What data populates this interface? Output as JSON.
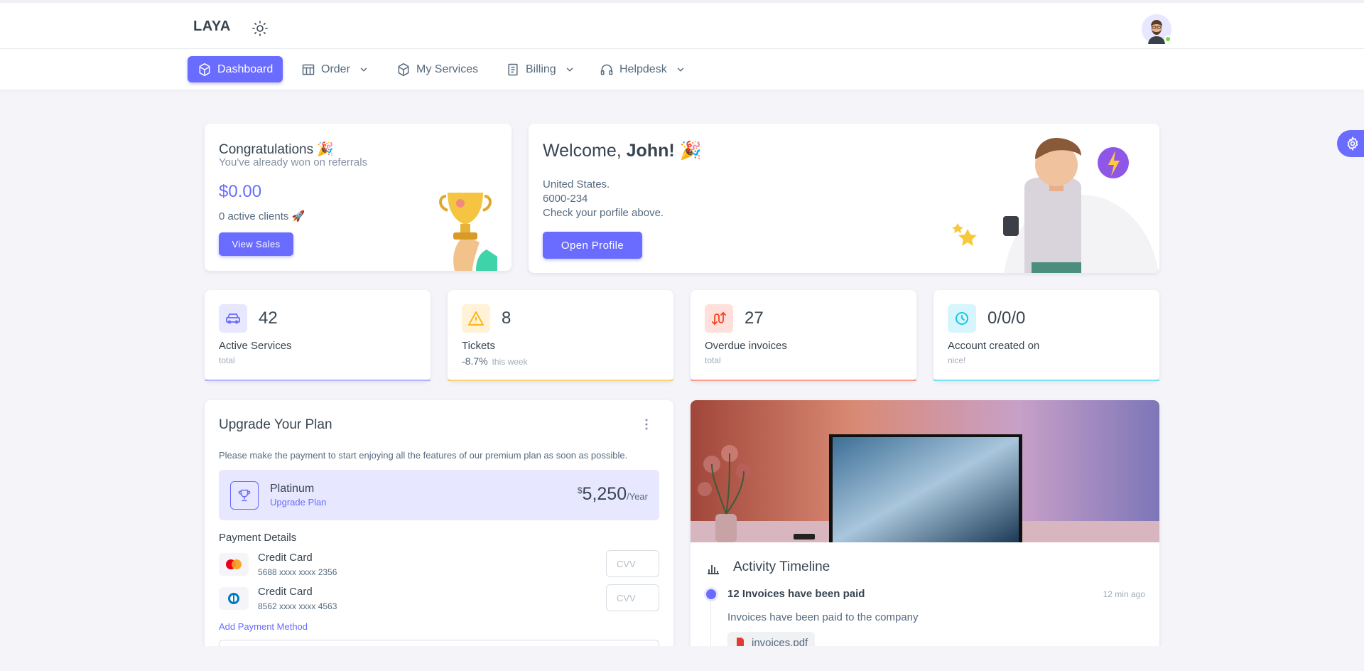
{
  "brand": {
    "name": "LAYA"
  },
  "nav": {
    "items": [
      {
        "label": "Dashboard",
        "icon": "cube-icon",
        "active": true,
        "dropdown": false
      },
      {
        "label": "Order",
        "icon": "table-icon",
        "active": false,
        "dropdown": true
      },
      {
        "label": "My Services",
        "icon": "box-icon",
        "active": false,
        "dropdown": false
      },
      {
        "label": "Billing",
        "icon": "file-icon",
        "active": false,
        "dropdown": true
      },
      {
        "label": "Helpdesk",
        "icon": "headset-icon",
        "active": false,
        "dropdown": true
      }
    ]
  },
  "congrats": {
    "title": "Congratulations 🎉",
    "subtitle": "You've already won on referrals",
    "amount": "$0.00",
    "clients": "0 active clients 🚀",
    "button": "View Sales"
  },
  "welcome": {
    "title_prefix": "Welcome, ",
    "name": "John! 🎉",
    "line1": "United States.",
    "line2": "6000-234",
    "line3": "Check your porfile above.",
    "button": "Open Profile"
  },
  "stats": [
    {
      "value": "42",
      "label": "Active Services",
      "meta": "total",
      "color": "#696cff",
      "icon": "car-icon"
    },
    {
      "value": "8",
      "label": "Tickets",
      "pct": "-8.7%",
      "meta": "this week",
      "color": "#ffab00",
      "icon": "warning-icon"
    },
    {
      "value": "27",
      "label": "Overdue invoices",
      "meta": "total",
      "color": "#ff3e1d",
      "icon": "route-icon"
    },
    {
      "value": "0/0/0",
      "label": "Account created on",
      "meta": "nice!",
      "color": "#03c3ec",
      "icon": "clock-icon"
    }
  ],
  "upgrade": {
    "title": "Upgrade Your Plan",
    "description": "Please make the payment to start enjoying all the features of our premium plan as soon as possible.",
    "plan": {
      "name": "Platinum",
      "link": "Upgrade Plan",
      "currency": "$",
      "price": "5,250",
      "period": "/Year"
    },
    "payment_title": "Payment Details",
    "cards": [
      {
        "name": "Credit Card",
        "number": "5688 xxxx xxxx 2356",
        "cvv_placeholder": "CVV",
        "brand": "mastercard"
      },
      {
        "name": "Credit Card",
        "number": "8562 xxxx xxxx 4563",
        "cvv_placeholder": "CVV",
        "brand": "diners"
      }
    ],
    "add_payment": "Add Payment Method"
  },
  "activity": {
    "title": "Activity Timeline",
    "items": [
      {
        "title": "12 Invoices have been paid",
        "time": "12 min ago",
        "desc": "Invoices have been paid to the company",
        "file": "invoices.pdf"
      }
    ]
  },
  "colors": {
    "primary": "#696cff",
    "warning": "#ffab00",
    "danger": "#ff3e1d",
    "info": "#03c3ec",
    "success": "#71dd37"
  }
}
